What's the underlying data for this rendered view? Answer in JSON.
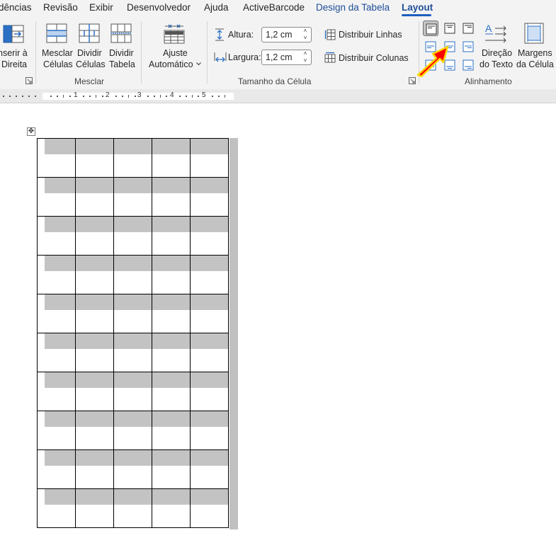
{
  "tabs": [
    "dências",
    "Revisão",
    "Exibir",
    "Desenvolvedor",
    "Ajuda",
    "ActiveBarcode",
    "Design da Tabela",
    "Layout"
  ],
  "active_tab": "Layout",
  "ribbon": {
    "insert_right": {
      "line1": "nserir à",
      "line2": "Direita"
    },
    "merge_cells": {
      "line1": "Mesclar",
      "line2": "Células"
    },
    "split_cells": {
      "line1": "Dividir",
      "line2": "Células"
    },
    "split_table": {
      "line1": "Dividir",
      "line2": "Tabela"
    },
    "autofit": {
      "line1": "Ajuste",
      "line2": "Automático"
    },
    "height_label": "Altura:",
    "height_value": "1,2 cm",
    "width_label": "Largura:",
    "width_value": "1,2 cm",
    "distribute_rows": "Distribuir Linhas",
    "distribute_cols": "Distribuir Colunas",
    "text_direction": {
      "line1": "Direção",
      "line2": "do Texto"
    },
    "cell_margins": {
      "line1": "Margens",
      "line2": "da Célula"
    },
    "groups": {
      "merge": "Mesclar",
      "cell_size": "Tamanho da Célula",
      "alignment": "Alinhamento"
    },
    "colors": {
      "accent": "#1f4e99",
      "pointer_arrow": "#ff0000",
      "pointer_outline": "#ffd800"
    }
  },
  "ruler": {
    "numbers": [
      "1",
      "2",
      "3",
      "4",
      "5"
    ]
  },
  "table": {
    "rows": 10,
    "cols": 5
  }
}
